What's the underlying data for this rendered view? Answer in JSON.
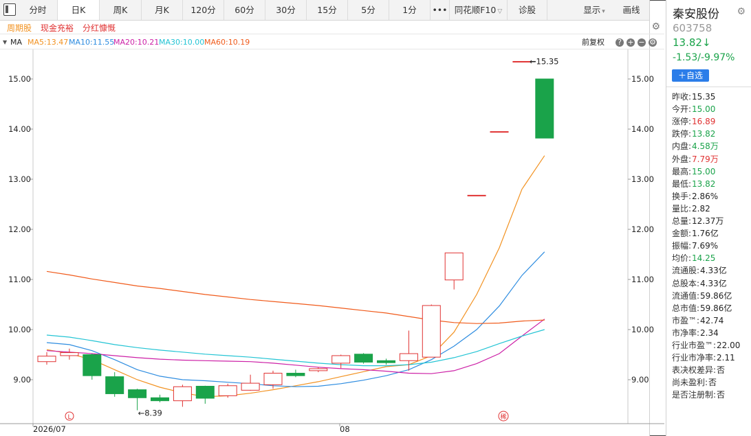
{
  "tabs": [
    {
      "label": "分时"
    },
    {
      "label": "日K"
    },
    {
      "label": "周K"
    },
    {
      "label": "月K"
    },
    {
      "label": "120分"
    },
    {
      "label": "60分"
    },
    {
      "label": "30分"
    },
    {
      "label": "15分"
    },
    {
      "label": "5分"
    },
    {
      "label": "1分"
    },
    {
      "label": "•••"
    },
    {
      "label": "同花顺F10"
    },
    {
      "label": "诊股"
    }
  ],
  "display_label": "显示",
  "draw_label": "画线",
  "subtags": [
    "周期股",
    "现金充裕",
    "分红慷慨"
  ],
  "ma": {
    "label": "MA",
    "ma5": "MA5:13.47",
    "ma10": "MA10:11.55",
    "ma20": "MA20:10.21",
    "ma30": "MA30:10.00",
    "ma60": "MA60:10.19",
    "restore_label": "前复权"
  },
  "chart_data": {
    "type": "candlestick",
    "y_ticks": [
      "15.00",
      "14.00",
      "13.00",
      "12.00",
      "11.00",
      "10.00",
      "9.00"
    ],
    "ylim": [
      8.2,
      15.6
    ],
    "x_labels": [
      "2026/07",
      "08"
    ],
    "annotations": {
      "high": "15.35",
      "low": "8.39"
    },
    "marker_l": "L",
    "marker_div": "稀",
    "candles": [
      {
        "o": 9.36,
        "c": 9.47,
        "h": 9.55,
        "l": 9.3
      },
      {
        "o": 9.48,
        "c": 9.54,
        "h": 9.62,
        "l": 9.4
      },
      {
        "o": 9.5,
        "c": 9.08,
        "h": 9.52,
        "l": 9.0
      },
      {
        "o": 9.06,
        "c": 8.72,
        "h": 9.15,
        "l": 8.66
      },
      {
        "o": 8.8,
        "c": 8.64,
        "h": 8.82,
        "l": 8.39
      },
      {
        "o": 8.64,
        "c": 8.58,
        "h": 8.7,
        "l": 8.55
      },
      {
        "o": 8.58,
        "c": 8.86,
        "h": 8.9,
        "l": 8.46
      },
      {
        "o": 8.87,
        "c": 8.63,
        "h": 8.88,
        "l": 8.52
      },
      {
        "o": 8.68,
        "c": 8.88,
        "h": 8.92,
        "l": 8.64
      },
      {
        "o": 8.79,
        "c": 8.93,
        "h": 9.1,
        "l": 8.78
      },
      {
        "o": 8.9,
        "c": 9.13,
        "h": 9.18,
        "l": 8.82
      },
      {
        "o": 9.13,
        "c": 9.08,
        "h": 9.2,
        "l": 9.05
      },
      {
        "o": 9.18,
        "c": 9.22,
        "h": 9.25,
        "l": 9.15
      },
      {
        "o": 9.33,
        "c": 9.48,
        "h": 9.5,
        "l": 9.23
      },
      {
        "o": 9.51,
        "c": 9.35,
        "h": 9.53,
        "l": 9.32
      },
      {
        "o": 9.38,
        "c": 9.34,
        "h": 9.42,
        "l": 9.3
      },
      {
        "o": 9.38,
        "c": 9.52,
        "h": 9.98,
        "l": 9.18
      },
      {
        "o": 9.45,
        "c": 10.48,
        "h": 10.5,
        "l": 9.45
      },
      {
        "o": 10.99,
        "c": 11.53,
        "h": 11.53,
        "l": 10.8
      },
      {
        "o": 12.68,
        "c": 12.68,
        "h": 12.68,
        "l": 12.68
      },
      {
        "o": 13.95,
        "c": 13.95,
        "h": 13.95,
        "l": 13.95
      },
      {
        "o": 15.35,
        "c": 15.35,
        "h": 15.35,
        "l": 15.35
      },
      {
        "o": 15.0,
        "c": 13.82,
        "h": 15.0,
        "l": 13.82
      }
    ],
    "series": [
      {
        "name": "MA5",
        "color": "#f29221",
        "values": [
          9.6,
          9.52,
          9.4,
          9.2,
          9.0,
          8.85,
          8.74,
          8.66,
          8.68,
          8.73,
          8.8,
          8.88,
          8.96,
          9.06,
          9.16,
          9.26,
          9.3,
          9.48,
          9.95,
          10.7,
          11.63,
          12.8,
          13.47
        ]
      },
      {
        "name": "MA10",
        "color": "#2d8ce0",
        "values": [
          9.74,
          9.7,
          9.58,
          9.4,
          9.2,
          9.07,
          9.0,
          8.98,
          8.95,
          8.92,
          8.88,
          8.86,
          8.87,
          8.92,
          8.99,
          9.08,
          9.2,
          9.4,
          9.67,
          10.0,
          10.47,
          11.08,
          11.55
        ]
      },
      {
        "name": "MA20",
        "color": "#cc1fa6",
        "values": [
          9.58,
          9.55,
          9.52,
          9.48,
          9.44,
          9.41,
          9.39,
          9.38,
          9.37,
          9.36,
          9.33,
          9.29,
          9.25,
          9.22,
          9.2,
          9.17,
          9.13,
          9.12,
          9.18,
          9.32,
          9.52,
          9.87,
          10.21
        ]
      },
      {
        "name": "MA30",
        "color": "#22c4d4",
        "values": [
          9.89,
          9.85,
          9.78,
          9.7,
          9.64,
          9.59,
          9.55,
          9.51,
          9.48,
          9.45,
          9.41,
          9.37,
          9.33,
          9.3,
          9.28,
          9.28,
          9.3,
          9.35,
          9.44,
          9.56,
          9.72,
          9.87,
          10.0
        ]
      },
      {
        "name": "MA60",
        "color": "#f05a1a",
        "values": [
          11.16,
          11.09,
          11.01,
          10.94,
          10.87,
          10.82,
          10.76,
          10.7,
          10.65,
          10.6,
          10.56,
          10.52,
          10.48,
          10.43,
          10.38,
          10.33,
          10.26,
          10.19,
          10.14,
          10.12,
          10.13,
          10.17,
          10.19
        ]
      }
    ],
    "ylabel": "",
    "xlabel": "",
    "title": ""
  },
  "stock": {
    "name": "秦安股份",
    "code": "603758",
    "price": "13.82↓",
    "change": "-1.53/-9.97%",
    "add_label": "＋自选"
  },
  "quote_rows": [
    {
      "k": "昨收:",
      "v": "15.35",
      "c": "dark"
    },
    {
      "k": "今开:",
      "v": "15.00",
      "c": "green"
    },
    {
      "k": "涨停:",
      "v": "16.89",
      "c": "red"
    },
    {
      "k": "跌停:",
      "v": "13.82",
      "c": "green"
    },
    {
      "k": "内盘:",
      "v": "4.58万",
      "c": "green"
    },
    {
      "k": "外盘:",
      "v": "7.79万",
      "c": "red"
    },
    {
      "k": "最高:",
      "v": "15.00",
      "c": "green"
    },
    {
      "k": "最低:",
      "v": "13.82",
      "c": "green"
    },
    {
      "k": "换手:",
      "v": "2.86%",
      "c": "dark"
    },
    {
      "k": "量比:",
      "v": "2.82",
      "c": "dark"
    },
    {
      "k": "总量:",
      "v": "12.37万",
      "c": "dark"
    },
    {
      "k": "金额:",
      "v": "1.76亿",
      "c": "dark"
    },
    {
      "k": "振幅:",
      "v": "7.69%",
      "c": "dark"
    },
    {
      "k": "均价:",
      "v": "14.25",
      "c": "green"
    },
    {
      "k": "流通股:",
      "v": "4.33亿",
      "c": "dark"
    },
    {
      "k": "总股本:",
      "v": "4.33亿",
      "c": "dark"
    },
    {
      "k": "流通值:",
      "v": "59.86亿",
      "c": "dark"
    },
    {
      "k": "总市值:",
      "v": "59.86亿",
      "c": "dark"
    },
    {
      "k": "市盈™:",
      "v": "42.74",
      "c": "dark"
    },
    {
      "k": "市净率:",
      "v": "2.34",
      "c": "dark"
    },
    {
      "k": "行业市盈™:",
      "v": "22.00",
      "c": "dark"
    },
    {
      "k": "行业市净率:",
      "v": "2.11",
      "c": "dark"
    },
    {
      "k": "表决权差异:",
      "v": "否",
      "c": "dark"
    },
    {
      "k": "尚未盈利:",
      "v": "否",
      "c": "dark"
    },
    {
      "k": "是否注册制:",
      "v": "否",
      "c": "dark"
    }
  ]
}
